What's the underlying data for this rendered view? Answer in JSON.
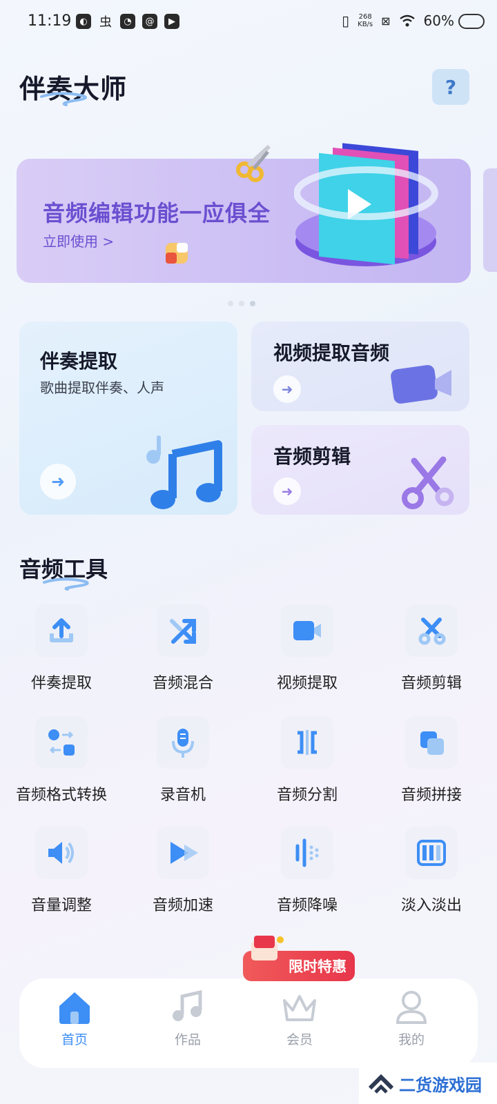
{
  "status_bar": {
    "time": "11:19",
    "net_speed": "268",
    "net_unit": "KB/s",
    "battery": "60%"
  },
  "header": {
    "title": "伴奏大师",
    "help_label": "?"
  },
  "banner": {
    "title": "音频编辑功能一应俱全",
    "link": "立即使用 >"
  },
  "cards": {
    "big": {
      "title": "伴奏提取",
      "subtitle": "歌曲提取伴奏、人声"
    },
    "video": {
      "title": "视频提取音频"
    },
    "edit": {
      "title": "音频剪辑"
    }
  },
  "tools_section": {
    "title": "音频工具",
    "items": [
      {
        "label": "伴奏提取",
        "icon": "upload-icon"
      },
      {
        "label": "音频混合",
        "icon": "shuffle-icon"
      },
      {
        "label": "视频提取",
        "icon": "video-camera-icon"
      },
      {
        "label": "音频剪辑",
        "icon": "scissors-icon"
      },
      {
        "label": "音频格式转换",
        "icon": "format-convert-icon"
      },
      {
        "label": "录音机",
        "icon": "microphone-icon"
      },
      {
        "label": "音频分割",
        "icon": "split-icon"
      },
      {
        "label": "音频拼接",
        "icon": "merge-icon"
      },
      {
        "label": "音量调整",
        "icon": "volume-icon"
      },
      {
        "label": "音频加速",
        "icon": "speed-icon"
      },
      {
        "label": "音频降噪",
        "icon": "denoise-icon"
      },
      {
        "label": "淡入淡出",
        "icon": "fade-icon"
      }
    ]
  },
  "promo": {
    "label": "限时特惠"
  },
  "nav": {
    "items": [
      {
        "label": "首页",
        "icon": "home-icon",
        "active": true
      },
      {
        "label": "作品",
        "icon": "music-note-icon",
        "active": false
      },
      {
        "label": "会员",
        "icon": "crown-icon",
        "active": false
      },
      {
        "label": "我的",
        "icon": "user-icon",
        "active": false
      }
    ]
  },
  "watermark": {
    "text": "二货游戏园"
  },
  "colors": {
    "accent": "#3d8ef5",
    "banner_text": "#6b4fd0",
    "promo": "#e8364b"
  }
}
